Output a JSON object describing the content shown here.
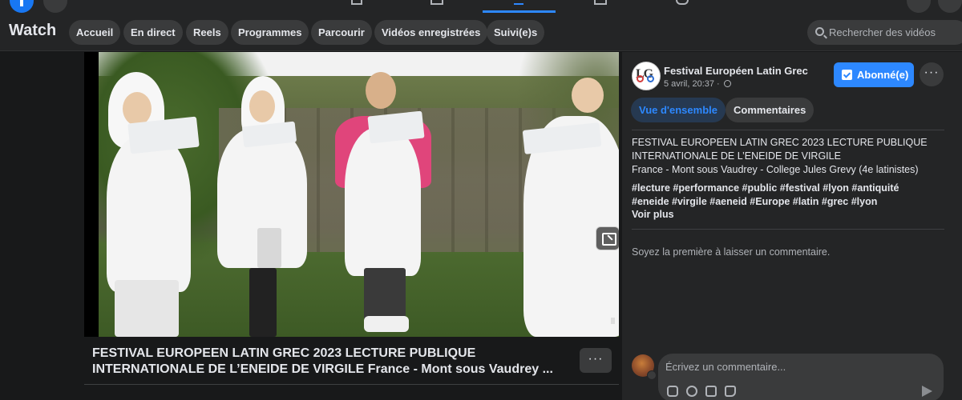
{
  "watch": {
    "title": "Watch",
    "tabs": [
      "Accueil",
      "En direct",
      "Reels",
      "Programmes",
      "Parcourir",
      "Vidéos enregistrées",
      "Suivi(e)s"
    ],
    "search_placeholder": "Rechercher des vidéos"
  },
  "video": {
    "title_line1": "FESTIVAL EUROPEEN LATIN GREC 2023 LECTURE PUBLIQUE",
    "title_line2": "INTERNATIONALE DE L’ENEIDE DE VIRGILE France - Mont sous Vaudrey ..."
  },
  "post": {
    "page_name": "Festival Européen Latin Grec",
    "date": "5 avril, 20:37 ·",
    "subscribed_label": "Abonné(e)",
    "tabs": {
      "overview": "Vue d'ensemble",
      "comments": "Commentaires"
    },
    "description_line1": "FESTIVAL EUROPEEN LATIN GREC 2023 LECTURE PUBLIQUE",
    "description_line2": "INTERNATIONALE DE L’ENEIDE DE VIRGILE",
    "description_line3": "France - Mont sous Vaudrey - College Jules Grevy (4e latinistes)",
    "hashtags": "#lecture #performance #public #festival #lyon #antiquité #eneide #virgile #aeneid #Europe #latin #grec #lyon",
    "see_more": "Voir plus",
    "no_comments": "Soyez la première à laisser un commentaire.",
    "comment_placeholder": "Écrivez un commentaire..."
  },
  "colors": {
    "accent": "#2d88ff",
    "background": "#18191a",
    "surface": "#242526"
  }
}
